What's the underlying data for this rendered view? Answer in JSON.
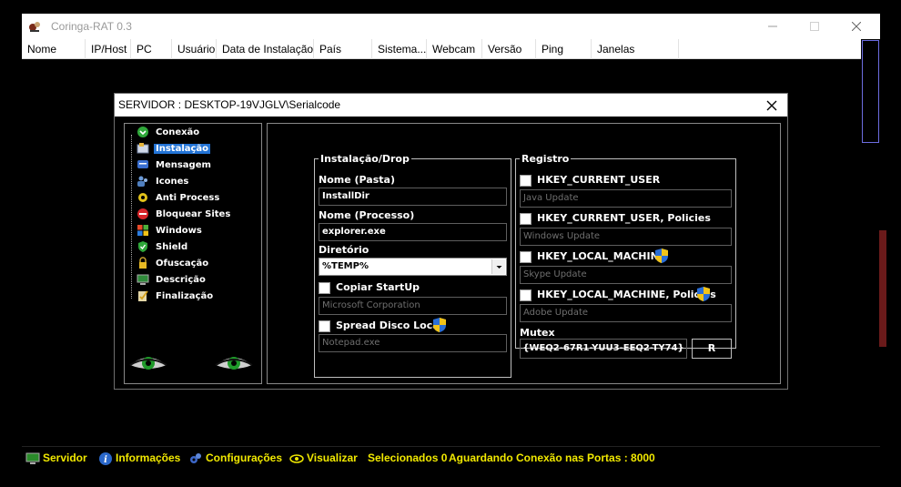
{
  "window": {
    "title": "Coringa-RAT 0.3"
  },
  "columns": [
    "Nome",
    "IP/Host",
    "PC",
    "Usuário",
    "Data de Instalação",
    "País",
    "Sistema...",
    "Webcam",
    "Versão",
    "Ping",
    "Janelas"
  ],
  "status": {
    "servidor": "Servidor",
    "informacoes": "Informações",
    "configuracoes": "Configurações",
    "visualizar": "Visualizar",
    "selecionados": "Selecionados 0",
    "aguardando": "Aguardando Conexão nas Portas : 8000"
  },
  "dialog": {
    "title": "SERVIDOR : DESKTOP-19VJGLV\\Serialcode",
    "tree": [
      "Conexão",
      "Instalação",
      "Mensagem",
      "Icones",
      "Anti Process",
      "Bloquear Sites",
      "Windows",
      "Shield",
      "Ofuscação",
      "Descrição",
      "Finalização"
    ],
    "selected_tree_item": "Instalação",
    "install": {
      "legend": "Instalação/Drop",
      "nome_pasta_label": "Nome (Pasta)",
      "nome_pasta_value": "InstallDir",
      "nome_processo_label": "Nome (Processo)",
      "nome_processo_value": "explorer.exe",
      "diretorio_label": "Diretório",
      "diretorio_value": "%TEMP%",
      "copiar_label": "Copiar StartUp",
      "copiar_value": "Microsoft Corporation",
      "spread_label": "Spread Disco Local",
      "spread_value": "Notepad.exe"
    },
    "registry": {
      "legend": "Registro",
      "hkcu_label": "HKEY_CURRENT_USER",
      "hkcu_value": "Java Update",
      "hkcu_pol_label": "HKEY_CURRENT_USER, Policies",
      "hkcu_pol_value": "Windows Update",
      "hklm_label": "HKEY_LOCAL_MACHINE",
      "hklm_value": "Skype Update",
      "hklm_pol_label": "HKEY_LOCAL_MACHINE, Policies",
      "hklm_pol_value": "Adobe Update",
      "mutex_label": "Mutex",
      "mutex_value": "{WEQ2-67R1-YUU3-EEQ2-TY74}",
      "r_button": "R"
    }
  },
  "colors": {
    "status_text": "#f1e900",
    "selection": "#2374d6",
    "background": "#000000"
  }
}
